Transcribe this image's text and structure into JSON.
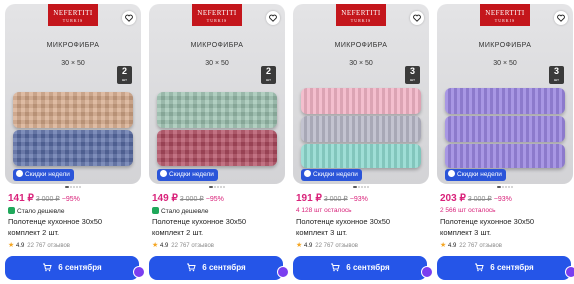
{
  "colors": {
    "accent": "#2555e8",
    "price": "#d9227a",
    "badge": "#2b55d9",
    "green": "#1fa85a"
  },
  "cards": [
    {
      "brand": "NEFERTITI",
      "brand_sub": "TURKIS",
      "material": "МИКРОФИБРА",
      "size": "30 × 50",
      "pcs": "2",
      "pcs_unit": "шт",
      "badge": "Скидки недели",
      "price": "141 ₽",
      "old_price": "3 000 ₽",
      "discount": "−95%",
      "promo": "Стало дешевле",
      "title_line1": "Полотенце кухонное 30х50",
      "title_line2": "комплект 2 шт.",
      "rating": "4.9",
      "reviews": "22 767 отзывов",
      "delivery": "6 сентября",
      "towel_colors": [
        "#d6a98a",
        "#5b6fa8"
      ]
    },
    {
      "brand": "NEFERTITI",
      "brand_sub": "TURKIS",
      "material": "МИКРОФИБРА",
      "size": "30 × 50",
      "pcs": "2",
      "pcs_unit": "шт",
      "badge": "Скидки недели",
      "price": "149 ₽",
      "old_price": "3 000 ₽",
      "discount": "−95%",
      "promo": "Стало дешевле",
      "title_line1": "Полотенце кухонное 30х50",
      "title_line2": "комплект 2 шт.",
      "rating": "4.9",
      "reviews": "22 767 отзывов",
      "delivery": "6 сентября",
      "towel_colors": [
        "#9cc2b0",
        "#b24d62"
      ]
    },
    {
      "brand": "NEFERTITI",
      "brand_sub": "TURKIS",
      "material": "МИКРОФИБРА",
      "size": "30 × 50",
      "pcs": "3",
      "pcs_unit": "шт",
      "badge": "Скидки недели",
      "price": "191 ₽",
      "old_price": "3 000 ₽",
      "discount": "−93%",
      "promo": "4 128 шт осталось",
      "title_line1": "Полотенце кухонное 30х50",
      "title_line2": "комплект 3 шт.",
      "rating": "4.9",
      "reviews": "22 767 отзывов",
      "delivery": "6 сентября",
      "towel_colors": [
        "#f2b4c6",
        "#b9b9c8",
        "#8fd9cf"
      ]
    },
    {
      "brand": "NEFERTITI",
      "brand_sub": "TURKIS",
      "material": "МИКРОФИБРА",
      "size": "30 × 50",
      "pcs": "3",
      "pcs_unit": "шт",
      "badge": "Скидки недели",
      "price": "203 ₽",
      "old_price": "3 000 ₽",
      "discount": "−93%",
      "promo": "2 566 шт осталось",
      "title_line1": "Полотенце кухонное 30х50",
      "title_line2": "комплект 3 шт.",
      "rating": "4.9",
      "reviews": "22 767 отзывов",
      "delivery": "6 сентября",
      "towel_colors": [
        "#9a86e0",
        "#9a86e0",
        "#9a86e0"
      ]
    }
  ]
}
